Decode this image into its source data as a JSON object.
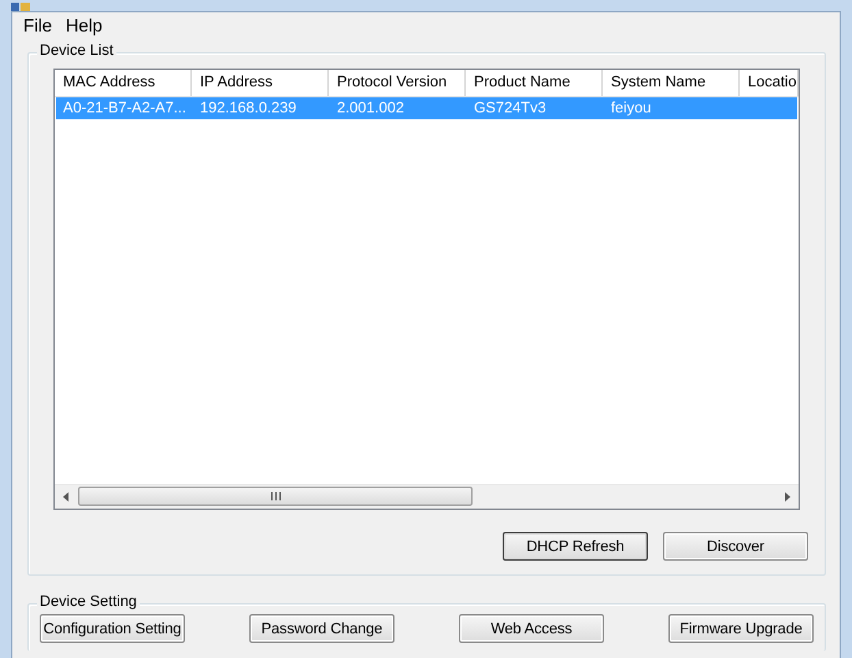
{
  "menu": [
    {
      "label": "File"
    },
    {
      "label": "Help"
    }
  ],
  "device_list": {
    "title": "Device List",
    "columns": [
      "MAC Address",
      "IP Address",
      "Protocol Version",
      "Product Name",
      "System Name",
      "Locatio"
    ],
    "rows": [
      {
        "cells": [
          "A0-21-B7-A2-A7...",
          "192.168.0.239",
          "2.001.002",
          "GS724Tv3",
          "feiyou",
          ""
        ],
        "selected": true
      }
    ],
    "buttons": [
      {
        "label": "DHCP Refresh",
        "default": true
      },
      {
        "label": "Discover",
        "default": false
      }
    ]
  },
  "device_setting": {
    "title": "Device Setting",
    "buttons": [
      {
        "label": "Configuration Setting"
      },
      {
        "label": "Password Change"
      },
      {
        "label": "Web Access"
      },
      {
        "label": "Firmware Upgrade"
      }
    ]
  }
}
